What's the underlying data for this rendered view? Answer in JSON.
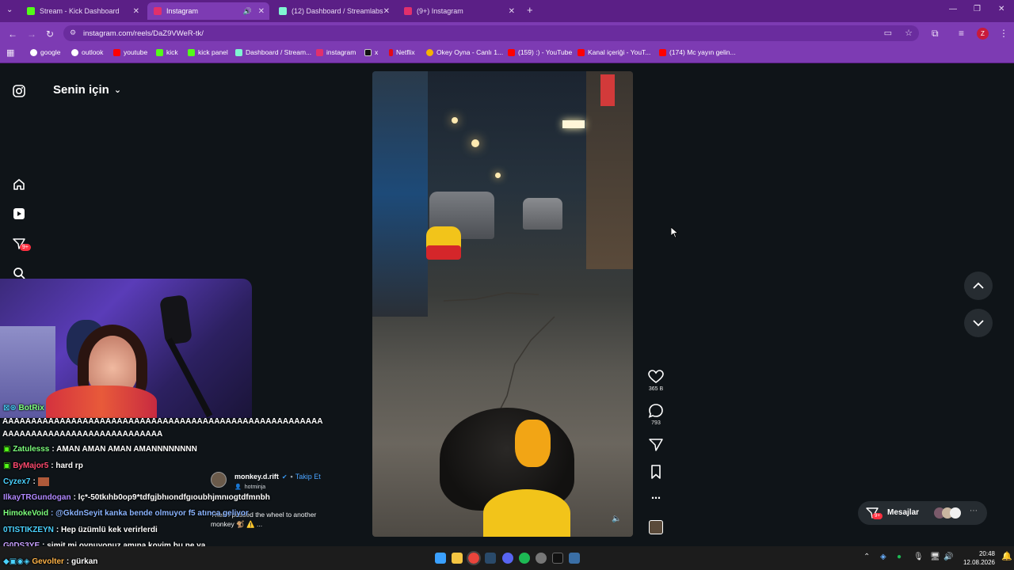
{
  "browser": {
    "tabs": [
      {
        "title": "Stream - Kick Dashboard",
        "color": "#53fc18"
      },
      {
        "title": "Instagram",
        "color": "#e1306c"
      },
      {
        "title": "(12) Dashboard / Streamlabs",
        "color": "#80f5d2"
      },
      {
        "title": "(9+) Instagram",
        "color": "#e1306c"
      }
    ],
    "url": "instagram.com/reels/DaZ9VWeR-tk/",
    "profile_initial": "Z",
    "bookmarks": [
      {
        "label": "google",
        "color": "#ffffff"
      },
      {
        "label": "outlook",
        "color": "#ffffff"
      },
      {
        "label": "youtube",
        "color": "#ff0000"
      },
      {
        "label": "kick",
        "color": "#53fc18"
      },
      {
        "label": "kick panel",
        "color": "#53fc18"
      },
      {
        "label": "Dashboard / Stream...",
        "color": "#80f5d2"
      },
      {
        "label": "instagram",
        "color": "#e1306c"
      },
      {
        "label": "x",
        "color": "#000000"
      },
      {
        "label": "Netflix",
        "color": "#e50914"
      },
      {
        "label": "Okey Oyna - Canlı 1...",
        "color": "#f5b301"
      },
      {
        "label": "(159) :) - YouTube",
        "color": "#ff0000"
      },
      {
        "label": "Kanal içeriği - YouT...",
        "color": "#ff0000"
      },
      {
        "label": "(174) Mc yayın gelin...",
        "color": "#ff0000"
      }
    ]
  },
  "instagram": {
    "feed_title": "Senin için",
    "notifications_badge": "9+",
    "likes": "365 B",
    "comments": "793",
    "author": {
      "username": "monkey.d.rift",
      "follow_label": "Takip Et",
      "audio": "hotminja",
      "caption": "Then I passed the wheel to another monkey 🐒 ⚠️ ..."
    },
    "messages_label": "Mesajlar",
    "messages_badge": "9+"
  },
  "stream_chat": {
    "partial_top_name": "BotRix",
    "spam_line_1": "AAAAAAAAAAAAAAAAAAAAAAAAAAAAAAAAAAAAAAAAAAAAAAAAAAAAAAAA",
    "spam_line_2": "AAAAAAAAAAAAAAAAAAAAAAAAAAAA",
    "messages": [
      {
        "user": "Zatulesss",
        "text": ": AMAN AMAN AMAN AMANNNNNNNN",
        "color": "#7cff7c"
      },
      {
        "user": "ByMajor5",
        "text": ": hard rp",
        "color": "#ff4a6e"
      },
      {
        "user": "Cyzex7",
        "text": ":",
        "color": "#4ad2ff"
      },
      {
        "user": "IlkayTRGundogan",
        "text": ": lç*-50tkıhb0op9*tdfgjbhıondfgıoubhjmnıogtdfmnbh",
        "color": "#b088ff"
      },
      {
        "user": "HimokeVoid",
        "text": ": @GkdnSeyit kanka bende olmuyor f5 atınca geliyor",
        "color": "#7cff7c"
      },
      {
        "user": "0TISTIKZEYN",
        "text": ": Hep üzümlü kek verirlerdi",
        "color": "#4ad2ff"
      },
      {
        "user": "G0DS3YE",
        "text": ": simit mi oynuyonuz amına koyim bu ne ya",
        "color": "#c8a0ff"
      },
      {
        "user": "Gevolter",
        "text": ": gürkan",
        "color": "#ffb347"
      }
    ]
  },
  "taskbar": {
    "time": "20:48",
    "date": "12.08.2026"
  }
}
